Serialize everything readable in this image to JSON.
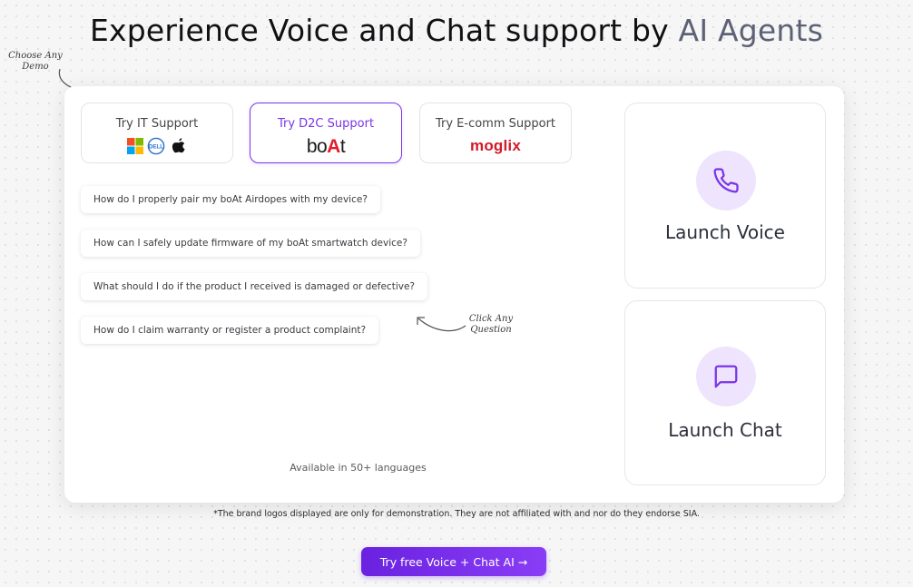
{
  "header": {
    "title_main": "Experience Voice and Chat support by",
    "title_accent": "AI Agents"
  },
  "notes": {
    "choose_demo": "Choose Any Demo",
    "click_question": "Click Any Question"
  },
  "demo_tabs": [
    {
      "label": "Try IT Support",
      "logos": [
        "microsoft-logo",
        "dell-logo",
        "apple-logo"
      ],
      "active": false
    },
    {
      "label": "Try D2C Support",
      "logo_text_left": "bo",
      "logo_text_accent": "A",
      "logo_text_right": "t",
      "active": true
    },
    {
      "label": "Try E-comm Support",
      "logo_text": "moglix",
      "active": false
    }
  ],
  "questions": [
    "How do I properly pair my boAt Airdopes with my device?",
    "How can I safely update firmware of my boAt smartwatch device?",
    "What should I do if the product I received is damaged or defective?",
    "How do I claim warranty or register a product complaint?"
  ],
  "languages_note": "Available in 50+ languages",
  "launch": {
    "voice_label": "Launch Voice",
    "voice_icon": "phone-icon",
    "chat_label": "Launch Chat",
    "chat_icon": "chat-bubble-icon"
  },
  "disclaimer": "*The brand logos displayed are only for demonstration. They are not affiliated with and nor do they endorse SIA.",
  "cta": {
    "label": "Try free Voice + Chat AI →"
  },
  "colors": {
    "accent": "#7a35e6",
    "accent_light": "#efe4fd",
    "brand_red": "#e11d2a"
  }
}
